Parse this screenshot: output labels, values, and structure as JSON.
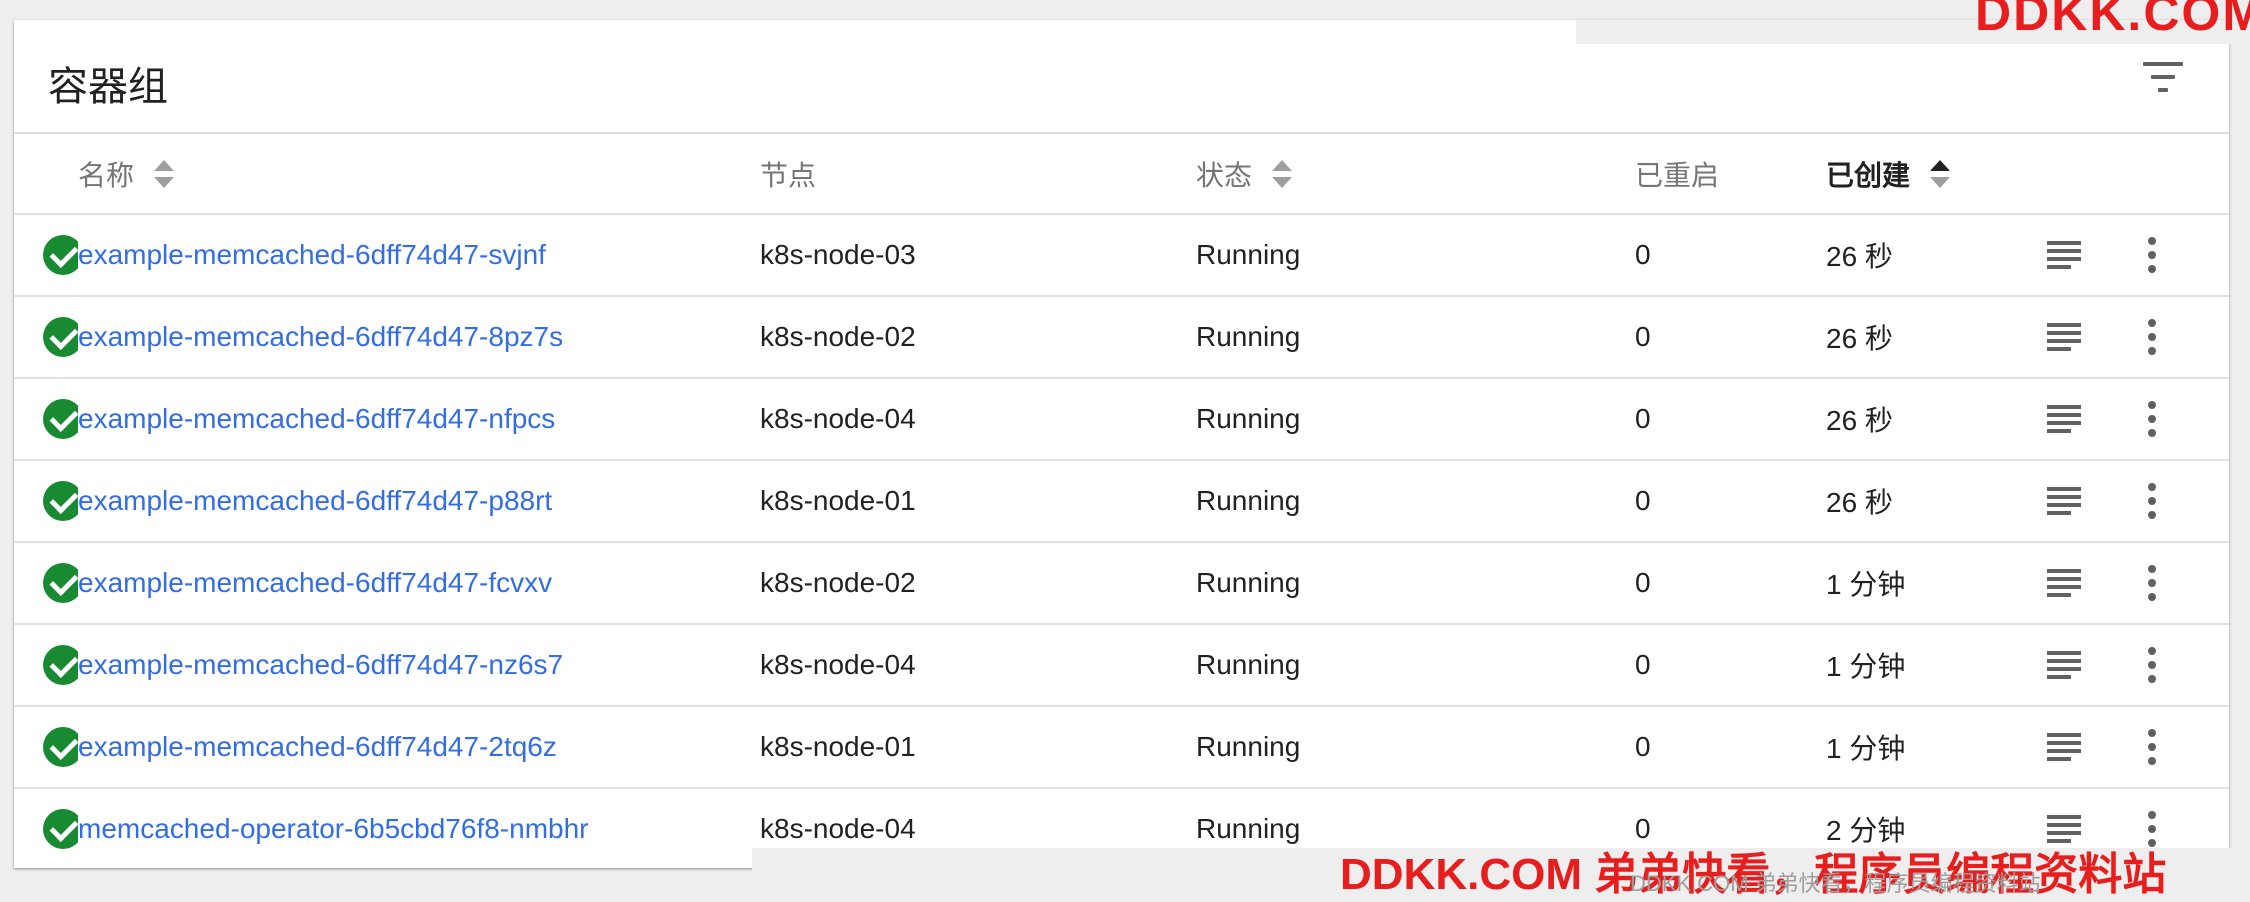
{
  "card": {
    "title": "容器组"
  },
  "columns": {
    "name": "名称",
    "node": "节点",
    "status": "状态",
    "restarts": "已重启",
    "created": "已创建"
  },
  "rows": [
    {
      "name": "example-memcached-6dff74d47-svjnf",
      "node": "k8s-node-03",
      "status": "Running",
      "restarts": "0",
      "age": "26 秒"
    },
    {
      "name": "example-memcached-6dff74d47-8pz7s",
      "node": "k8s-node-02",
      "status": "Running",
      "restarts": "0",
      "age": "26 秒"
    },
    {
      "name": "example-memcached-6dff74d47-nfpcs",
      "node": "k8s-node-04",
      "status": "Running",
      "restarts": "0",
      "age": "26 秒"
    },
    {
      "name": "example-memcached-6dff74d47-p88rt",
      "node": "k8s-node-01",
      "status": "Running",
      "restarts": "0",
      "age": "26 秒"
    },
    {
      "name": "example-memcached-6dff74d47-fcvxv",
      "node": "k8s-node-02",
      "status": "Running",
      "restarts": "0",
      "age": "1 分钟"
    },
    {
      "name": "example-memcached-6dff74d47-nz6s7",
      "node": "k8s-node-04",
      "status": "Running",
      "restarts": "0",
      "age": "1 分钟"
    },
    {
      "name": "example-memcached-6dff74d47-2tq6z",
      "node": "k8s-node-01",
      "status": "Running",
      "restarts": "0",
      "age": "1 分钟"
    },
    {
      "name": "memcached-operator-6b5cbd76f8-nmbhr",
      "node": "k8s-node-04",
      "status": "Running",
      "restarts": "0",
      "age": "2 分钟"
    }
  ],
  "icons": {
    "status": "check-circle-icon",
    "logs": "logs-icon",
    "more": "more-vert-icon",
    "filter": "filter-icon"
  },
  "colors": {
    "link": "#326de6",
    "success": "#188a32",
    "watermark": "#e81d1d"
  },
  "watermark": {
    "top": "DDKK.COM",
    "bottom": "DDKK.COM 弟弟快看，程序员编程资料站",
    "bottom_small": "DDKK.COM 弟弟快看，程序员编程资料站"
  }
}
